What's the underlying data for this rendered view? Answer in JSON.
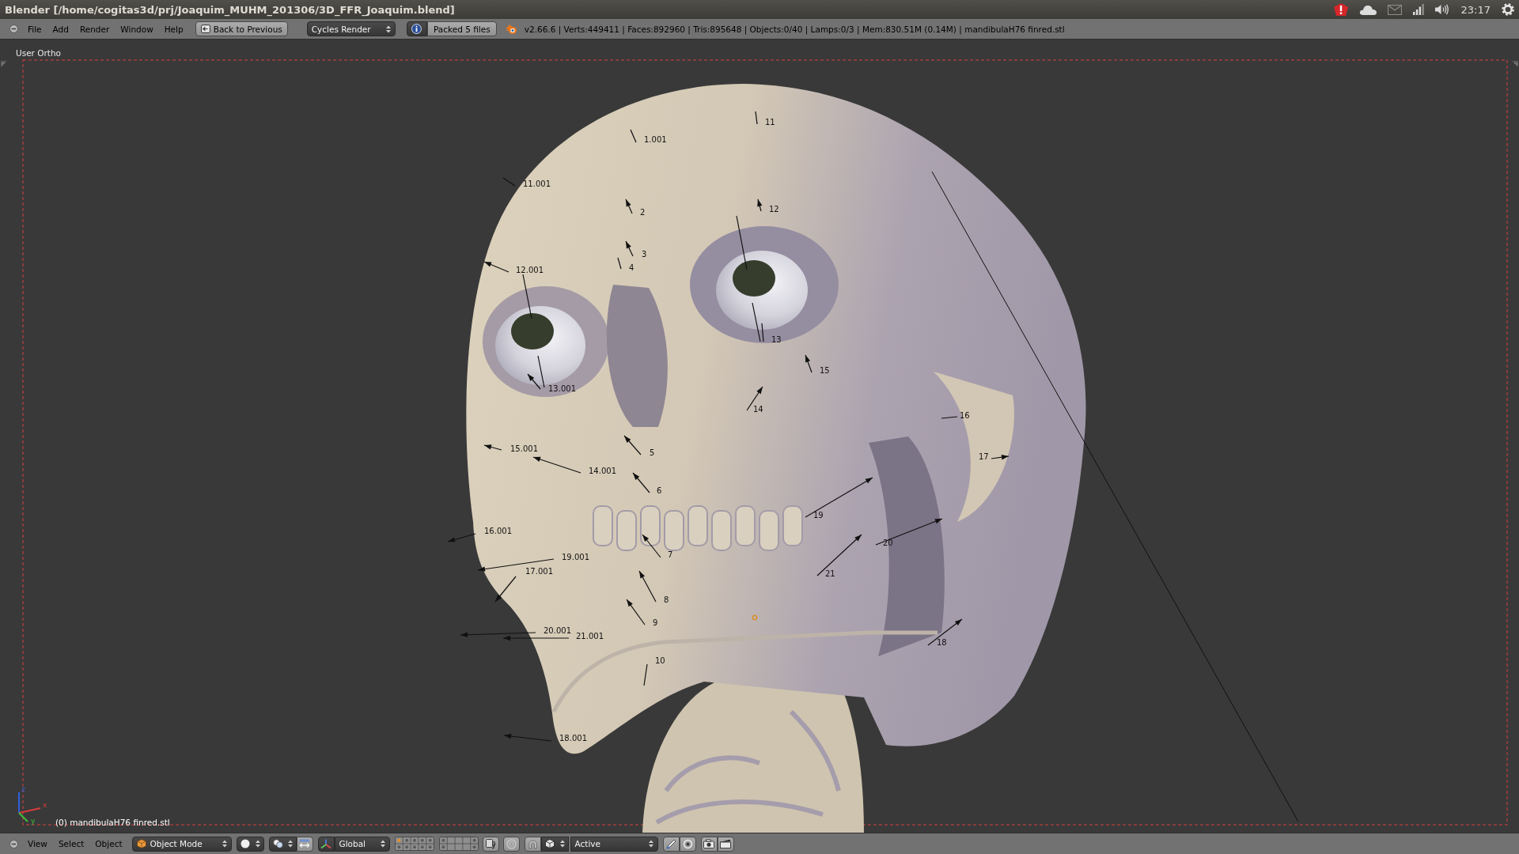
{
  "window": {
    "title": "Blender [/home/cogitas3d/prj/Joaquim_MUHM_201306/3D_FFR_Joaquim.blend]"
  },
  "system_tray": {
    "clock": "23:17"
  },
  "info_header": {
    "menus": [
      "File",
      "Add",
      "Render",
      "Window",
      "Help"
    ],
    "back_button": "Back to Previous",
    "render_engine": "Cycles Render",
    "packed_files": "Packed 5 files",
    "stats": "v2.66.6 | Verts:449411 | Faces:892960 | Tris:895648 | Objects:0/40 | Lamps:0/3 | Mem:830.51M (0.14M) | mandibulaH76 finred.stl"
  },
  "viewport": {
    "view_name": "User Ortho",
    "annotations": [
      "11",
      "1.001",
      "11.001",
      "12",
      "2",
      "3",
      "4",
      "12.001",
      "13",
      "15",
      "13.001",
      "14",
      "16",
      "15.001",
      "5",
      "17",
      "14.001",
      "6",
      "19",
      "16.001",
      "20",
      "7",
      "19.001",
      "17.001",
      "21",
      "8",
      "9",
      "20.001",
      "21.001",
      "18",
      "10",
      "18.001"
    ],
    "axes": [
      {
        "label": "z",
        "color": "#3060d8"
      },
      {
        "label": "x",
        "color": "#d83c3c"
      },
      {
        "label": "y",
        "color": "#3cc03c"
      }
    ],
    "object_label": "(0) mandibulaH76 finred.stl"
  },
  "view3d_header": {
    "menus": [
      "View",
      "Select",
      "Object"
    ],
    "mode": "Object Mode",
    "orientation": "Global",
    "snap_target": "Active"
  }
}
